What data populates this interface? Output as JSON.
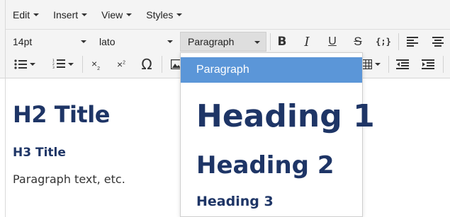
{
  "menubar": {
    "items": [
      {
        "label": "Edit"
      },
      {
        "label": "Insert"
      },
      {
        "label": "View"
      },
      {
        "label": "Styles"
      }
    ]
  },
  "toolbar": {
    "font_size": "14pt",
    "font_family": "lato",
    "block_format": "Paragraph",
    "buttons_row1": [
      "bold-icon",
      "italic-icon",
      "underline-icon",
      "strikethrough-icon",
      "code-icon",
      "align-left-icon",
      "align-center-icon"
    ],
    "buttons_row2": [
      "bullet-list-icon",
      "numbered-list-icon",
      "subscript-icon",
      "superscript-icon",
      "omega-icon",
      "image-icon",
      "table-icon",
      "outdent-icon",
      "indent-icon"
    ]
  },
  "editor": {
    "h2": "H2 Title",
    "h3": "H3 Title",
    "paragraph": "Paragraph text, etc."
  },
  "format_dropdown": {
    "items": [
      {
        "label": "Paragraph",
        "selected": true
      },
      {
        "label": "Heading 1"
      },
      {
        "label": "Heading 2"
      },
      {
        "label": "Heading 3"
      }
    ]
  },
  "colors": {
    "heading": "#1e3566",
    "selection": "#5b96d8",
    "toolbar_bg": "#f4f4f4"
  }
}
